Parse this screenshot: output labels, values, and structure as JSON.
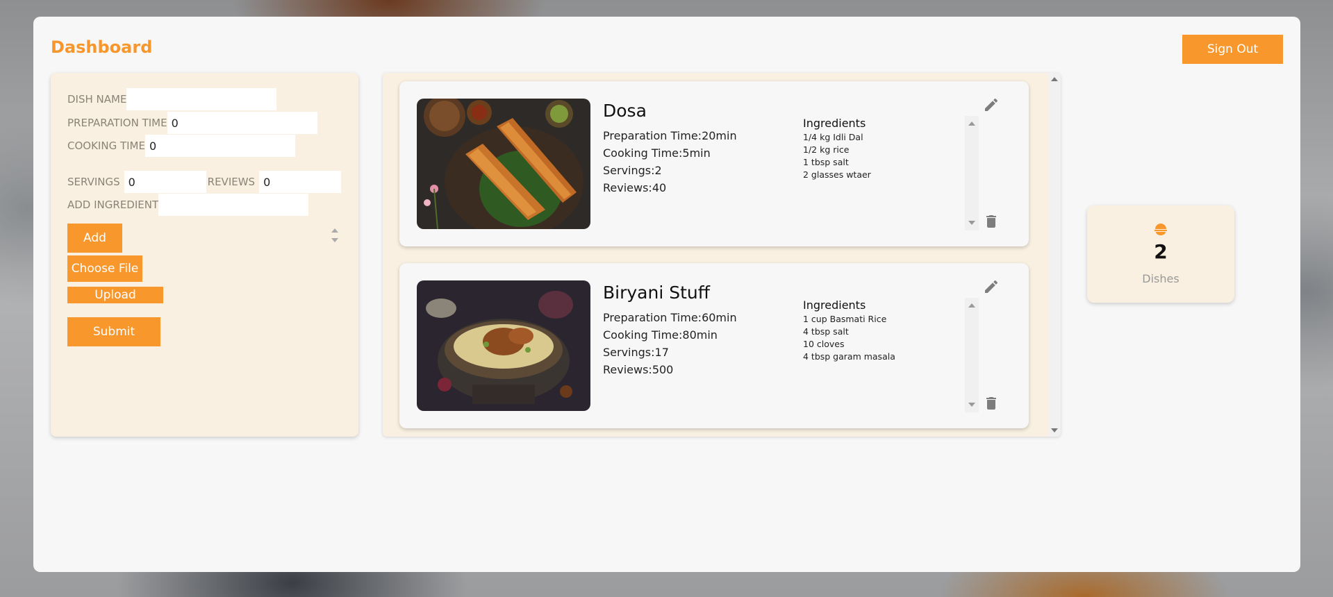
{
  "header": {
    "title": "Dashboard",
    "signout_label": "Sign Out"
  },
  "form": {
    "dish_name_label": "DISH NAME",
    "dish_name_value": "",
    "prep_label": "PREPARATION TIME",
    "prep_value": "0",
    "cook_label": "COOKING TIME",
    "cook_value": "0",
    "servings_label": "SERVINGS",
    "servings_value": "0",
    "reviews_label": "REVIEWS",
    "reviews_value": "0",
    "ingredient_label": "ADD INGREDIENT",
    "ingredient_value": "",
    "add_label": "Add",
    "choose_file_label": "Choose File",
    "upload_label": "Upload",
    "submit_label": "Submit"
  },
  "dishes": [
    {
      "name": "Dosa",
      "prep": "Preparation Time:20min",
      "cook": "Cooking Time:5min",
      "servings": "Servings:2",
      "reviews": "Reviews:40",
      "ingredients_heading": "Ingredients",
      "ingredients": [
        "1/4 kg Idli Dal",
        "1/2 kg rice",
        "1 tbsp salt",
        "2 glasses wtaer"
      ]
    },
    {
      "name": "Biryani Stuff",
      "prep": "Preparation Time:60min",
      "cook": "Cooking Time:80min",
      "servings": "Servings:17",
      "reviews": "Reviews:500",
      "ingredients_heading": "Ingredients",
      "ingredients": [
        "1 cup Basmati Rice",
        "4 tbsp salt",
        "10 cloves",
        "4 tbsp garam masala"
      ]
    }
  ],
  "stats": {
    "count": "2",
    "label": "Dishes",
    "icon": "food-bowl-icon"
  },
  "icons": {
    "edit": "pencil-icon",
    "delete": "trash-icon"
  },
  "colors": {
    "accent": "#f7972c",
    "card": "#f9f0e1",
    "panel": "#f7f7f7"
  }
}
